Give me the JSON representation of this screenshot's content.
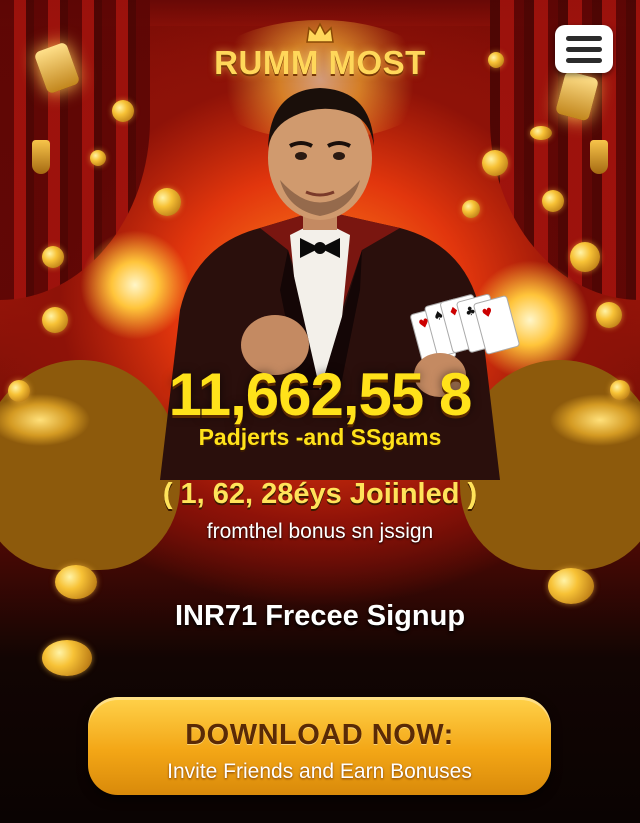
{
  "header": {
    "logo_text": "RUMM MOST",
    "menu_icon": "hamburger-menu-icon"
  },
  "hero": {
    "count": "11,662,55 8",
    "count_caption": "Padjerts -and SSgams",
    "joined": "( 1, 62, 28éys Joiinled )",
    "bonus_line": "fromthel bonus sn jssign",
    "offer": "INR71 Frecee Signup"
  },
  "cta": {
    "title": "DOWNLOAD NOW:",
    "subtitle": "Invite Friends and Earn Bonuses"
  },
  "colors": {
    "accent_yellow": "#ffe21a",
    "button_gold": "#f3a616",
    "background_red": "#a5170a"
  }
}
